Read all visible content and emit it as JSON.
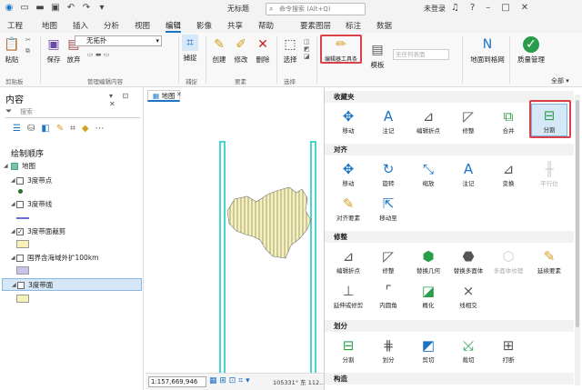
{
  "titlebar": {
    "title": "无标题",
    "search_placeholder": "命令搜索 (Alt+Q)",
    "login": "未登录",
    "qat_icons": [
      "app-icon",
      "new-icon",
      "open-icon",
      "save-icon",
      "undo-icon",
      "redo-icon",
      "dropdown-icon"
    ],
    "window_icons": [
      "notification-icon",
      "help-icon",
      "minimize-icon",
      "maximize-icon",
      "close-icon"
    ]
  },
  "tabs": {
    "items": [
      "工程",
      "地图",
      "插入",
      "分析",
      "视图",
      "编辑",
      "影像",
      "共享",
      "帮助",
      "要素图层",
      "标注",
      "数据"
    ],
    "active": "编辑",
    "context_group": "要素图层"
  },
  "ribbon": {
    "clipboard": {
      "paste": "粘贴",
      "label": "剪贴板"
    },
    "manage": {
      "save": "保存",
      "discard": "放弃",
      "topology_value": "无拓扑",
      "label": "管理编辑内容"
    },
    "snapping": {
      "snap": "捕捉",
      "label": "捕捉"
    },
    "features": {
      "create": "创建",
      "modify": "修改",
      "delete": "删除",
      "label": "要素"
    },
    "selection": {
      "select": "选择",
      "label": "选择"
    },
    "tools": {
      "edit_toolbox": "编辑器工具条",
      "template": "模板",
      "placeholder": "无任何表面"
    },
    "ground": {
      "ground_to_grid": "地面到格网"
    },
    "quality": {
      "quality_manage": "质量管理"
    },
    "full": "全部"
  },
  "contents": {
    "title": "内容",
    "search_placeholder": "搜索",
    "draw_order": "绘制顺序",
    "map_label": "地图",
    "layers": [
      {
        "name": "3度带点",
        "checked": false,
        "legend": "point"
      },
      {
        "name": "3度带线",
        "checked": false,
        "legend": "line"
      },
      {
        "name": "3度带面裁剪",
        "checked": true,
        "legend": "polygon-yellow"
      },
      {
        "name": "国界含海域外扩100km",
        "checked": false,
        "legend": "polygon-purple"
      },
      {
        "name": "3度带面",
        "checked": false,
        "legend": "polygon-yellow",
        "selected": true
      }
    ]
  },
  "map": {
    "tab_label": "地图",
    "scale": "1:157,669,946",
    "coords": "105331° 东 112..."
  },
  "tools_panel": {
    "full": "全部",
    "categories": [
      {
        "name": "收藏夹",
        "tools": [
          {
            "label": "移动",
            "icon": "move-icon"
          },
          {
            "label": "注记",
            "icon": "annotation-icon"
          },
          {
            "label": "编辑折点",
            "icon": "edit-vertices-icon"
          },
          {
            "label": "修整",
            "icon": "reshape-icon"
          },
          {
            "label": "合并",
            "icon": "merge-icon"
          },
          {
            "label": "分割",
            "icon": "split-icon",
            "selected": true
          }
        ]
      },
      {
        "name": "对齐",
        "tools": [
          {
            "label": "移动",
            "icon": "move-icon"
          },
          {
            "label": "旋转",
            "icon": "rotate-icon"
          },
          {
            "label": "缩放",
            "icon": "scale-icon"
          },
          {
            "label": "注记",
            "icon": "annotation-icon"
          },
          {
            "label": "变换",
            "icon": "transform-icon"
          },
          {
            "label": "平行位",
            "icon": "parallel-icon",
            "disabled": true
          },
          {
            "label": "对齐要素",
            "icon": "align-features-icon"
          },
          {
            "label": "移动至",
            "icon": "move-to-icon"
          }
        ]
      },
      {
        "name": "修整",
        "tools": [
          {
            "label": "编辑折点",
            "icon": "edit-vertices-icon"
          },
          {
            "label": "修整",
            "icon": "reshape-icon"
          },
          {
            "label": "替换几何",
            "icon": "replace-geometry-icon"
          },
          {
            "label": "替换多面体",
            "icon": "replace-multipatch-icon"
          },
          {
            "label": "多面体纹理",
            "icon": "multipatch-texture-icon",
            "disabled": true
          },
          {
            "label": "延续要素",
            "icon": "continue-feature-icon"
          },
          {
            "label": "延伸或修剪",
            "icon": "extend-trim-icon"
          },
          {
            "label": "内圆角",
            "icon": "fillet-icon"
          },
          {
            "label": "概化",
            "icon": "generalize-icon"
          },
          {
            "label": "线相交",
            "icon": "line-intersect-icon"
          }
        ]
      },
      {
        "name": "划分",
        "tools": [
          {
            "label": "分割",
            "icon": "split-icon"
          },
          {
            "label": "划分",
            "icon": "divide-icon"
          },
          {
            "label": "剪切",
            "icon": "clip-icon"
          },
          {
            "label": "裁切",
            "icon": "cut-icon"
          },
          {
            "label": "打断",
            "icon": "break-icon"
          }
        ]
      },
      {
        "name": "构造",
        "tools": []
      }
    ]
  },
  "colors": {
    "accent": "#1a73c4",
    "highlight": "#d9414a",
    "map_polygon_fill": "#f7f1b8",
    "map_line": "#46d6cf",
    "legend_purple": "#c9c3ec",
    "selected_bg": "#d6e8f7"
  }
}
